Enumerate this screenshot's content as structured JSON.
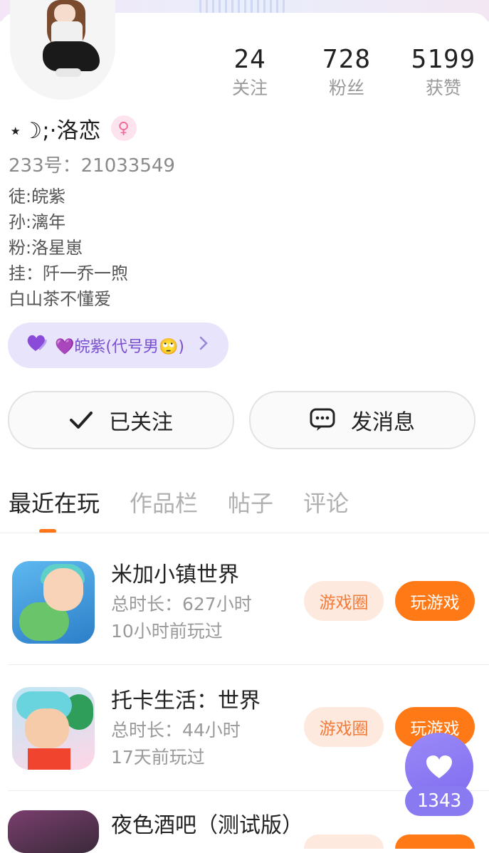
{
  "profile": {
    "name": "⋆☽;·洛恋",
    "gender_symbol": "♀",
    "uid": "233号：21033549",
    "bio": [
      "徒:皖紫",
      "孙:漓年",
      "粉:洛星崽",
      "挂：阡一乔一煦",
      "白山茶不懂爱"
    ]
  },
  "stats": [
    {
      "value": "24",
      "label": "关注"
    },
    {
      "value": "728",
      "label": "粉丝"
    },
    {
      "value": "5199",
      "label": "获赞"
    }
  ],
  "club_tag": {
    "text": "💜皖紫(代号男🙄)"
  },
  "actions": {
    "follow_label": "已关注",
    "message_label": "发消息"
  },
  "tabs": [
    {
      "label": "最近在玩",
      "active": true
    },
    {
      "label": "作品栏",
      "active": false
    },
    {
      "label": "帖子",
      "active": false
    },
    {
      "label": "评论",
      "active": false
    }
  ],
  "games": [
    {
      "title": "米加小镇世界",
      "duration": "总时长：627小时",
      "last_played": "10小时前玩过",
      "circle_label": "游戏圈",
      "play_label": "玩游戏"
    },
    {
      "title": "托卡生活：世界",
      "duration": "总时长：44小时",
      "last_played": "17天前玩过",
      "circle_label": "游戏圈",
      "play_label": "玩游戏"
    },
    {
      "title": "夜色酒吧（测试版）"
    }
  ],
  "like_fab": {
    "count": "1343"
  },
  "colors": {
    "accent": "#ff7a17",
    "fab": "#8a7af2",
    "club_bg": "#e8e4fb"
  }
}
